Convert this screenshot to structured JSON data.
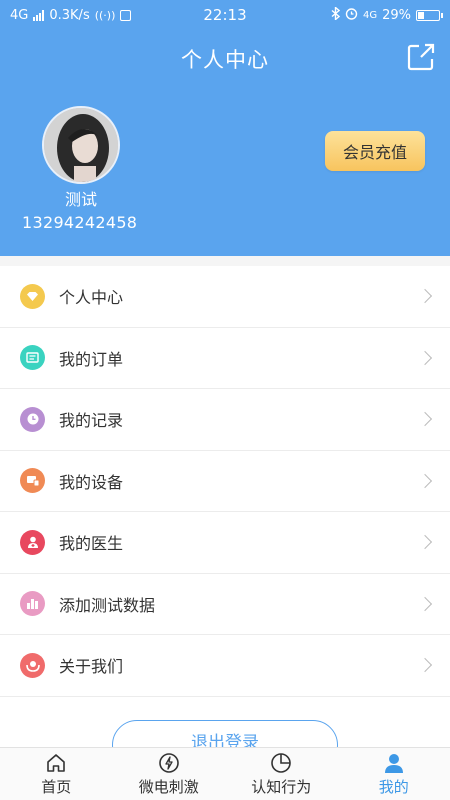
{
  "status_bar": {
    "network": "4G",
    "speed": "0.3K/s",
    "time": "22:13",
    "network_right": "4G",
    "battery": "29%",
    "battery_level": 0.29
  },
  "header": {
    "title": "个人中心",
    "username": "测试",
    "phone": "13294242458",
    "vip_button": "会员充值"
  },
  "menu": {
    "items": [
      {
        "label": "个人中心",
        "icon": "diamond-icon",
        "color": "#f4c94e"
      },
      {
        "label": "我的订单",
        "icon": "order-icon",
        "color": "#3ad3c0"
      },
      {
        "label": "我的记录",
        "icon": "clock-icon",
        "color": "#b88fd2"
      },
      {
        "label": "我的设备",
        "icon": "device-icon",
        "color": "#f08a55"
      },
      {
        "label": "我的医生",
        "icon": "doctor-icon",
        "color": "#e8485f"
      },
      {
        "label": "添加测试数据",
        "icon": "bar-chart-icon",
        "color": "#e99bc3"
      },
      {
        "label": "关于我们",
        "icon": "hands-icon",
        "color": "#f06b6b"
      }
    ]
  },
  "logout_label": "退出登录",
  "tabs": [
    {
      "label": "首页",
      "icon": "home-icon",
      "active": false
    },
    {
      "label": "微电刺激",
      "icon": "bolt-icon",
      "active": false
    },
    {
      "label": "认知行为",
      "icon": "pie-icon",
      "active": false
    },
    {
      "label": "我的",
      "icon": "user-icon",
      "active": true
    }
  ],
  "colors": {
    "header_bg": "#5aa4ee",
    "accent": "#3d98e6",
    "vip_gradient_top": "#fde29a",
    "vip_gradient_bottom": "#f8c45e"
  }
}
